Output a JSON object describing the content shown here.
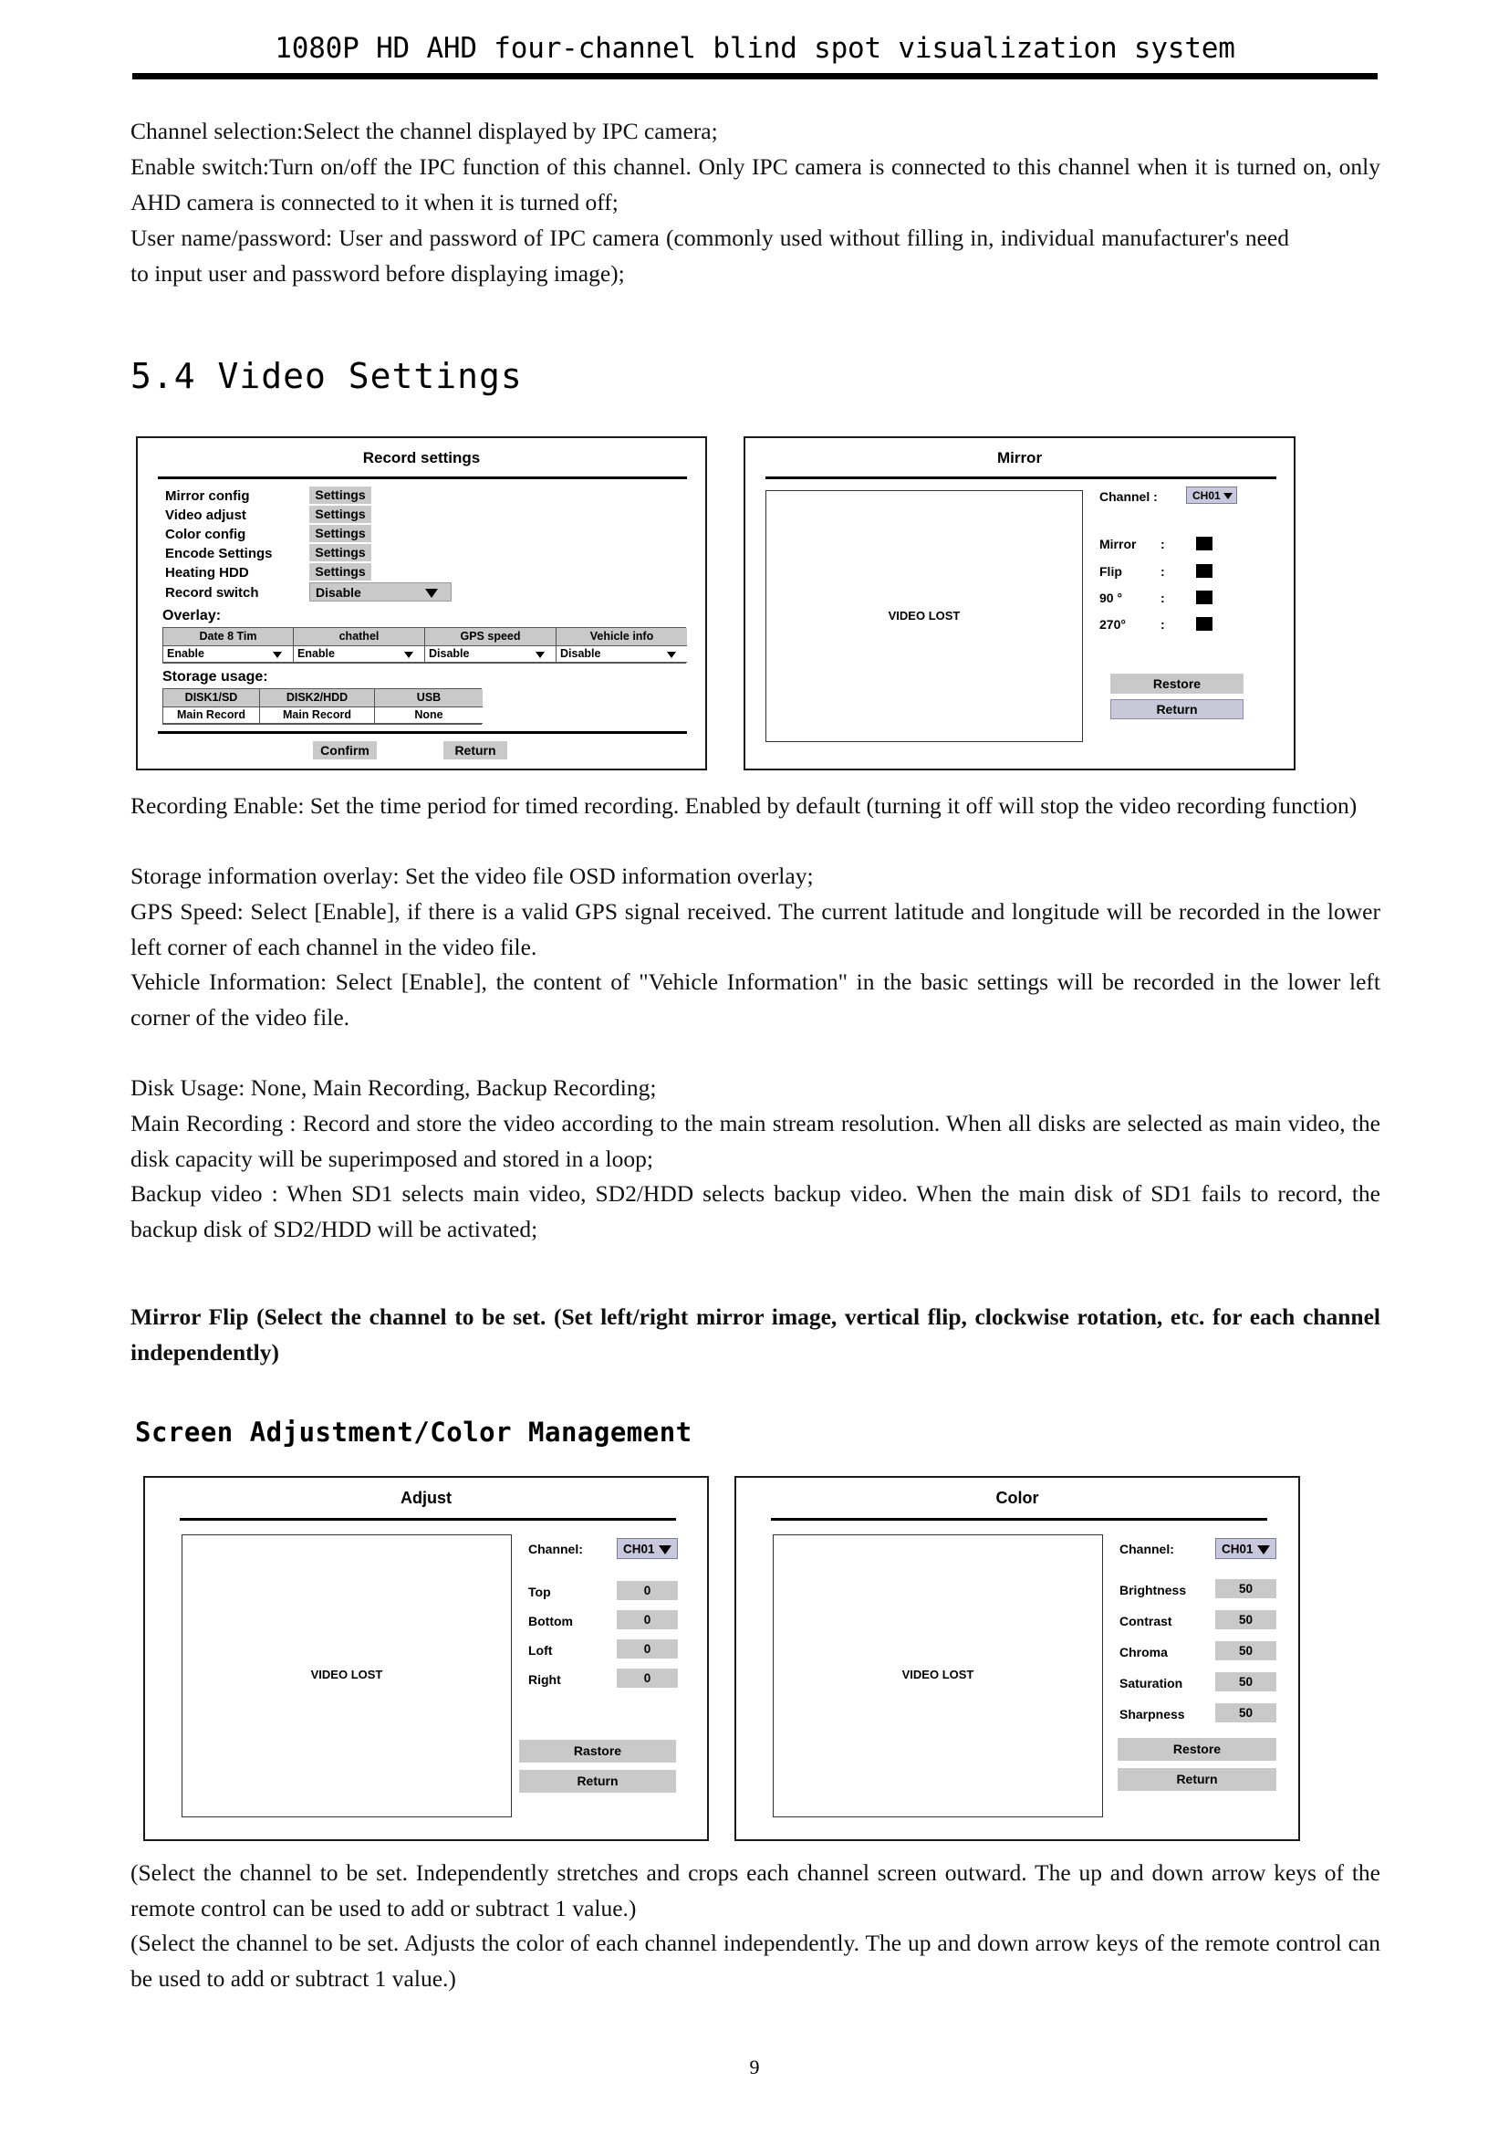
{
  "header": {
    "title": "1080P HD AHD four-channel blind spot visualization system"
  },
  "intro": {
    "line1": "Channel selection:Select the channel displayed by IPC camera;",
    "line2": "Enable switch:Turn on/off the IPC function of this channel. Only IPC camera is connected to this channel when it is turned on, only AHD camera is connected to it when it is turned off;",
    "line3": "User name/password: User and password of IPC camera (commonly used without filling in, individual manufacturer's need to input user and password before displaying image);"
  },
  "headings": {
    "video_settings": "5.4 Video Settings",
    "screen_adjustment": "Screen Adjustment/Color Management"
  },
  "record_settings": {
    "title": "Record settings",
    "rows": [
      {
        "label": "Mirror config",
        "button": "Settings"
      },
      {
        "label": "Video adjust",
        "button": "Settings"
      },
      {
        "label": "Color config",
        "button": "Settings"
      },
      {
        "label": "Encode Settings",
        "button": "Settings"
      },
      {
        "label": "Heating HDD",
        "button": "Settings"
      }
    ],
    "record_switch": {
      "label": "Record switch",
      "value": "Disable"
    },
    "overlay": {
      "section_label": "Overlay:",
      "headers": [
        "Date 8 Tim",
        "chathel",
        "GPS speed",
        "Vehicle info"
      ],
      "values": [
        "Enable",
        "Enable",
        "Disable",
        "Disable"
      ]
    },
    "storage": {
      "section_label": "Storage usage:",
      "headers": [
        "DISK1/SD",
        "DISK2/HDD",
        "USB"
      ],
      "values": [
        "Main Record",
        "Main Record",
        "None"
      ]
    },
    "confirm_label": "Confirm",
    "return_label": "Return"
  },
  "mirror": {
    "title": "Mirror",
    "video_lost": "VIDEO LOST",
    "channel_label": "Channel :",
    "channel_value": "CH01",
    "options": [
      {
        "label": "Mirror",
        "sep": ":"
      },
      {
        "label": "Flip",
        "sep": ":"
      },
      {
        "label": "90 °",
        "sep": ":"
      },
      {
        "label": "270°",
        "sep": ":"
      }
    ],
    "restore_label": "Restore",
    "return_label": "Return"
  },
  "adjust": {
    "title": "Adjust",
    "video_lost": "VIDEO LOST",
    "channel_label": "Channel:",
    "channel_value": "CH01",
    "fields": [
      {
        "label": "Top",
        "value": "0"
      },
      {
        "label": "Bottom",
        "value": "0"
      },
      {
        "label": "Loft",
        "value": "0"
      },
      {
        "label": "Right",
        "value": "0"
      }
    ],
    "restore_label": "Rastore",
    "return_label": "Return"
  },
  "color": {
    "title": "Color",
    "video_lost": "VIDEO LOST",
    "channel_label": "Channel:",
    "channel_value": "CH01",
    "fields": [
      {
        "label": "Brightness",
        "value": "50"
      },
      {
        "label": "Contrast",
        "value": "50"
      },
      {
        "label": "Chroma",
        "value": "50"
      },
      {
        "label": "Saturation",
        "value": "50"
      },
      {
        "label": "Sharpness",
        "value": "50"
      }
    ],
    "restore_label": "Restore",
    "return_label": "Return"
  },
  "body": {
    "p1": "Recording Enable: Set the time period for timed recording. Enabled by default (turning it off will stop the video recording function)",
    "p2": "Storage information overlay: Set the video file OSD information overlay;",
    "p3": "GPS Speed: Select [Enable], if there is a valid GPS signal received. The current latitude and longitude will be recorded in the lower left corner of each channel in the video file.",
    "p4": "Vehicle Information: Select [Enable], the content of \"Vehicle Information\" in the basic settings will be recorded in the lower left corner of the video file.",
    "p5": "Disk Usage: None, Main Recording, Backup Recording;",
    "p6": "Main Recording : Record and store the video according to the main stream resolution. When all disks are selected as main video, the disk capacity will be superimposed and stored in a loop;",
    "p7": "Backup video : When SD1 selects main video, SD2/HDD selects backup video. When the main disk of SD1 fails to record, the backup disk of SD2/HDD will be activated;",
    "p8": "Mirror Flip (Select the channel to be set. (Set left/right mirror image, vertical flip, clockwise rotation, etc. for each channel independently)",
    "p9": "(Select the channel to be set. Independently stretches and crops each channel screen outward. The up and down arrow keys of the remote control can be used to add or subtract 1 value.)",
    "p10": "(Select the channel to be set. Adjusts the color of each channel independently. The up and down arrow keys of the remote control can be used to add or subtract 1 value.)"
  },
  "footer": {
    "page_number": "9"
  }
}
